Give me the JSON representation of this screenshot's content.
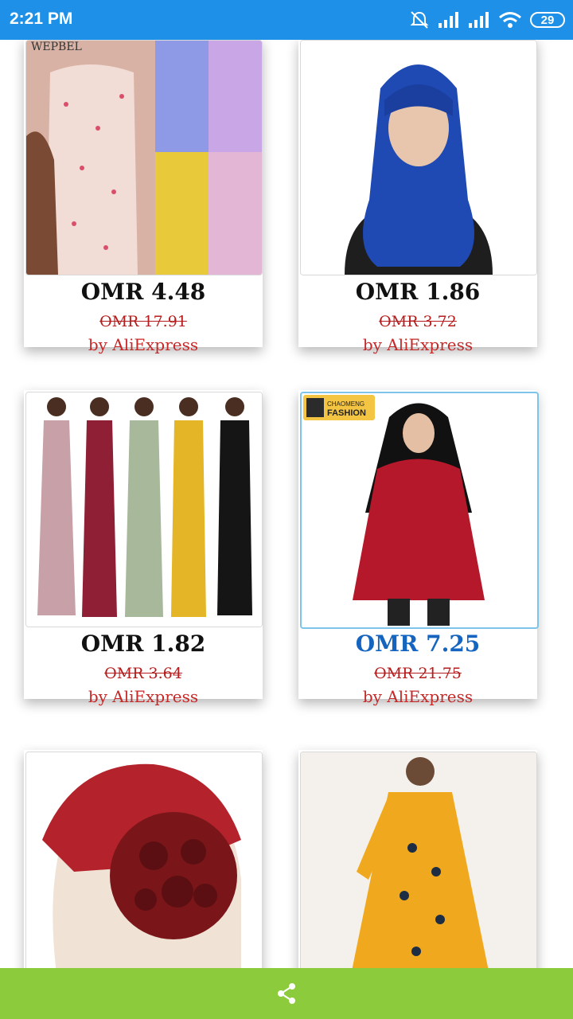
{
  "status_bar": {
    "time": "2:21 PM",
    "battery": "29"
  },
  "products": [
    {
      "price": "OMR 4.48",
      "old_price": "OMR 17.91",
      "seller": "by AliExpress",
      "image": "floral-slip-dress-collage",
      "logo_text": "WEPBEL"
    },
    {
      "price": "OMR 1.86",
      "old_price": "OMR 3.72",
      "seller": "by AliExpress",
      "image": "blue-hijab-model"
    },
    {
      "price": "OMR 1.82",
      "old_price": "OMR 3.64",
      "seller": "by AliExpress",
      "image": "long-bodycon-dresses-five-colors"
    },
    {
      "price": "OMR 7.25",
      "old_price": "OMR 21.75",
      "seller": "by AliExpress",
      "image": "red-sequin-tunic-hijab",
      "brand_line1": "CHAOMENG",
      "brand_line2": "FASHION"
    },
    {
      "price": "",
      "old_price": "",
      "seller": "",
      "image": "red-flower-turban-cap"
    },
    {
      "price": "",
      "old_price": "",
      "seller": "",
      "image": "yellow-embroidered-abaya"
    }
  ],
  "colors": {
    "status_bar": "#1e90e8",
    "bottom_bar": "#8ccc3c",
    "selected_price": "#1565c0",
    "seller_red": "#c62828"
  },
  "icons": {
    "share": "share-icon"
  }
}
